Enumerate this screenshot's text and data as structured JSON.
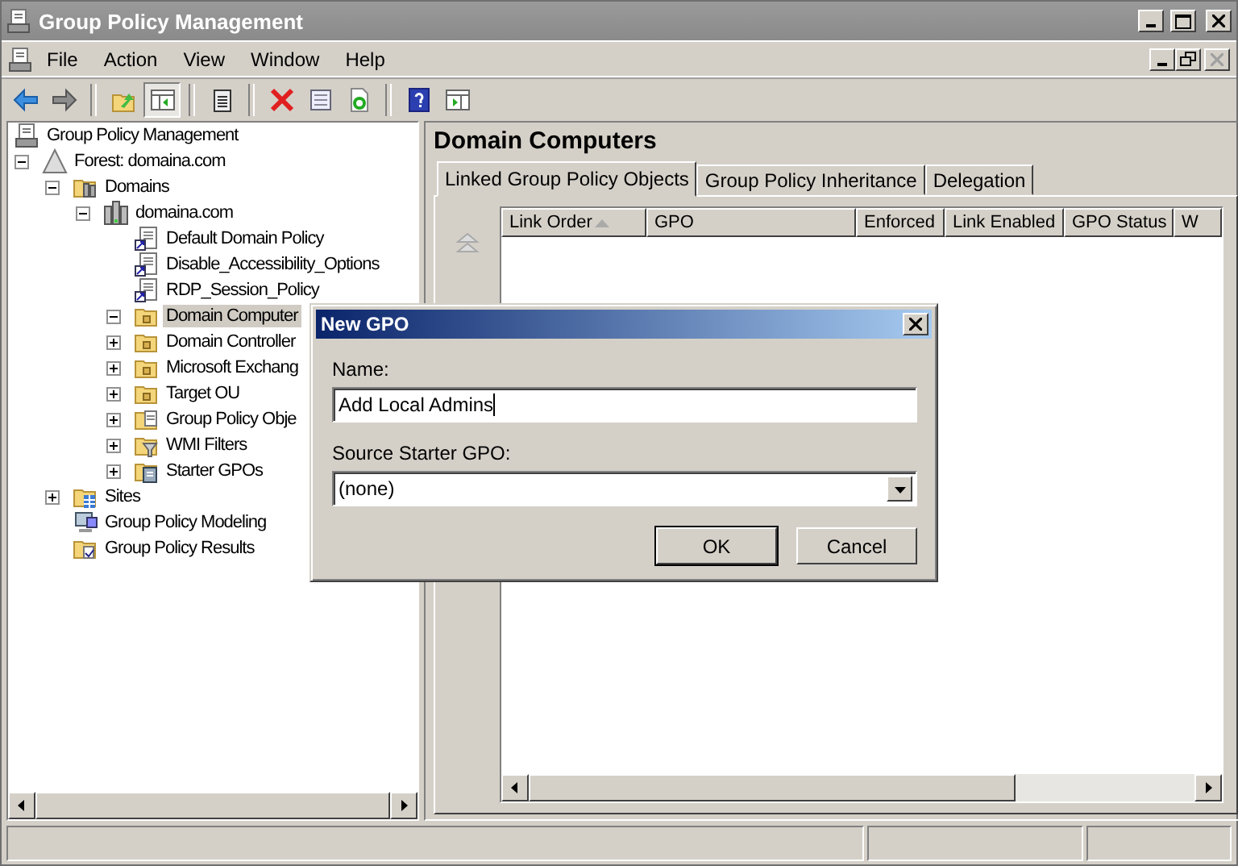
{
  "window": {
    "title": "Group Policy Management"
  },
  "menu": [
    "File",
    "Action",
    "View",
    "Window",
    "Help"
  ],
  "toolbar": [
    {
      "kind": "back",
      "pressed": false
    },
    {
      "kind": "forward",
      "pressed": false
    },
    {
      "kind": "sep"
    },
    {
      "kind": "up",
      "pressed": false
    },
    {
      "kind": "tree",
      "pressed": true
    },
    {
      "kind": "sep"
    },
    {
      "kind": "clipboard",
      "pressed": false
    },
    {
      "kind": "sep"
    },
    {
      "kind": "delete",
      "pressed": false
    },
    {
      "kind": "properties",
      "pressed": false
    },
    {
      "kind": "refresh",
      "pressed": false
    },
    {
      "kind": "sep"
    },
    {
      "kind": "help",
      "pressed": false
    },
    {
      "kind": "pane",
      "pressed": false
    }
  ],
  "tree": [
    {
      "label": "Group Policy Management",
      "kind": "console",
      "selected": false,
      "children": [
        {
          "label": "Forest: domaina.com",
          "kind": "forest",
          "selected": false,
          "expanded": true,
          "children": [
            {
              "label": "Domains",
              "kind": "domains",
              "selected": false,
              "expanded": true,
              "children": [
                {
                  "label": "domaina.com",
                  "kind": "domain",
                  "selected": false,
                  "expanded": true,
                  "children": [
                    {
                      "label": "Default Domain Policy",
                      "kind": "gpo-link",
                      "selected": false
                    },
                    {
                      "label": "Disable_Accessibility_Options",
                      "kind": "gpo-link",
                      "selected": false
                    },
                    {
                      "label": "RDP_Session_Policy",
                      "kind": "gpo-link",
                      "selected": false
                    },
                    {
                      "label": "Domain Computer",
                      "kind": "ou",
                      "selected": true,
                      "expanded": true
                    },
                    {
                      "label": "Domain Controller",
                      "kind": "ou",
                      "selected": false,
                      "expanded": false
                    },
                    {
                      "label": "Microsoft Exchang",
                      "kind": "ou",
                      "selected": false,
                      "expanded": false
                    },
                    {
                      "label": "Target OU",
                      "kind": "ou",
                      "selected": false,
                      "expanded": false
                    },
                    {
                      "label": "Group Policy Obje",
                      "kind": "gpo-folder",
                      "selected": false,
                      "expanded": false
                    },
                    {
                      "label": "WMI Filters",
                      "kind": "wmi",
                      "selected": false,
                      "expanded": false
                    },
                    {
                      "label": "Starter GPOs",
                      "kind": "starter",
                      "selected": false,
                      "expanded": false
                    }
                  ]
                }
              ]
            },
            {
              "label": "Sites",
              "kind": "sites",
              "selected": false,
              "expanded": false
            },
            {
              "label": "Group Policy Modeling",
              "kind": "modeling",
              "selected": false
            },
            {
              "label": "Group Policy Results",
              "kind": "results",
              "selected": false
            }
          ]
        }
      ]
    }
  ],
  "details": {
    "title": "Domain Computers",
    "tabs": [
      {
        "label": "Linked Group Policy Objects",
        "selected": true
      },
      {
        "label": "Group Policy Inheritance",
        "selected": false
      },
      {
        "label": "Delegation",
        "selected": false
      }
    ],
    "columns": [
      {
        "label": "Link Order",
        "sorted": true
      },
      {
        "label": "GPO",
        "sorted": false
      },
      {
        "label": "Enforced",
        "sorted": false
      },
      {
        "label": "Link Enabled",
        "sorted": false
      },
      {
        "label": "GPO Status",
        "sorted": false
      },
      {
        "label": "W",
        "sorted": false
      }
    ]
  },
  "dialog": {
    "title": "New GPO",
    "name_label": "Name:",
    "name_value": "Add Local Admins",
    "source_label": "Source Starter GPO:",
    "source_value": "(none)",
    "buttons": [
      {
        "label": "OK",
        "default": true
      },
      {
        "label": "Cancel",
        "default": false
      }
    ]
  }
}
